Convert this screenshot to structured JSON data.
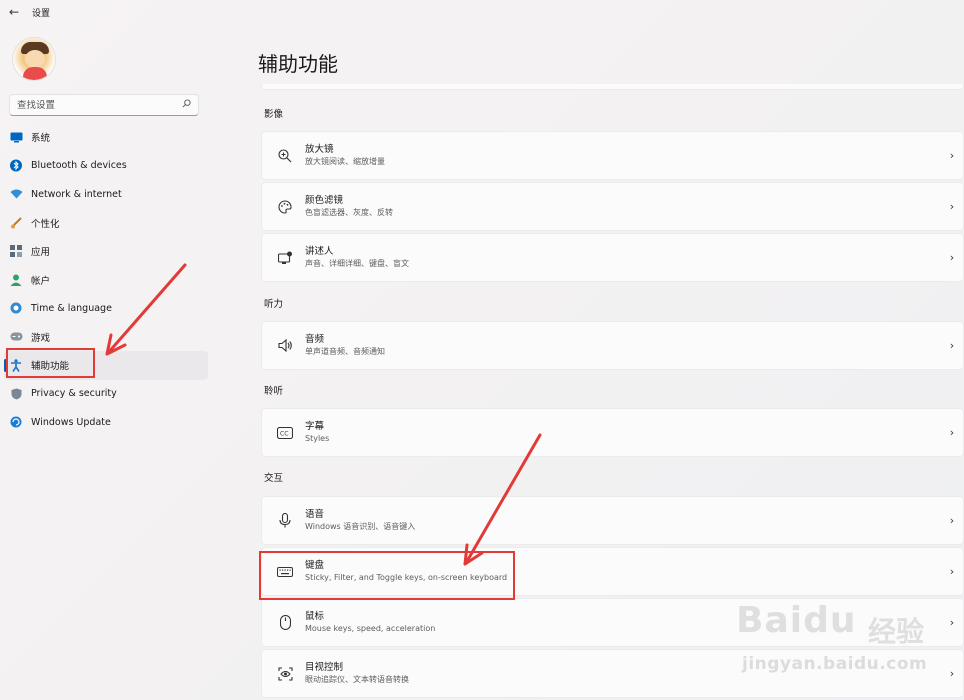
{
  "window": {
    "title": "设置",
    "back_glyph": "←"
  },
  "sidebar": {
    "search_placeholder": "查找设置",
    "items": [
      {
        "label": "系统",
        "icon": "monitor-icon"
      },
      {
        "label": "Bluetooth & devices",
        "icon": "bluetooth-icon"
      },
      {
        "label": "Network & internet",
        "icon": "wifi-icon"
      },
      {
        "label": "个性化",
        "icon": "brush-icon"
      },
      {
        "label": "应用",
        "icon": "apps-icon"
      },
      {
        "label": "帐户",
        "icon": "person-icon"
      },
      {
        "label": "Time & language",
        "icon": "globe-clock-icon"
      },
      {
        "label": "游戏",
        "icon": "gamepad-icon"
      },
      {
        "label": "辅助功能",
        "icon": "accessibility-icon",
        "active": true
      },
      {
        "label": "Privacy & security",
        "icon": "shield-icon"
      },
      {
        "label": "Windows Update",
        "icon": "update-icon"
      }
    ]
  },
  "main": {
    "title": "辅助功能",
    "sections": [
      {
        "label": "影像"
      },
      {
        "label": "听力"
      },
      {
        "label": "聆听"
      },
      {
        "label": "交互"
      }
    ],
    "cards": [
      {
        "title": "放大镜",
        "subtitle": "放大镜阅读、缩放增量",
        "icon": "magnifier-icon"
      },
      {
        "title": "颜色滤镜",
        "subtitle": "色盲滤选器、灰度、反转",
        "icon": "palette-icon"
      },
      {
        "title": "讲述人",
        "subtitle": "声音、详细详细、键盘、盲文",
        "icon": "narrator-icon"
      },
      {
        "title": "音频",
        "subtitle": "单声道音频、音频通知",
        "icon": "speaker-icon"
      },
      {
        "title": "字幕",
        "subtitle": "Styles",
        "icon": "captions-icon"
      },
      {
        "title": "语音",
        "subtitle": "Windows 语音识别、语音键入",
        "icon": "microphone-icon"
      },
      {
        "title": "键盘",
        "subtitle": "Sticky, Filter, and Toggle keys, on-screen keyboard",
        "icon": "keyboard-icon"
      },
      {
        "title": "鼠标",
        "subtitle": "Mouse keys, speed, acceleration",
        "icon": "mouse-icon"
      },
      {
        "title": "目视控制",
        "subtitle": "眼动追踪仪、文本转语音转换",
        "icon": "eye-control-icon"
      }
    ],
    "chevron_glyph": "›"
  },
  "watermark": {
    "brand": "Baidu",
    "brand_cn": "经验",
    "url": "jingyan.baidu.com"
  },
  "colors": {
    "accent": "#005fb8",
    "annotation": "#e23a36"
  }
}
